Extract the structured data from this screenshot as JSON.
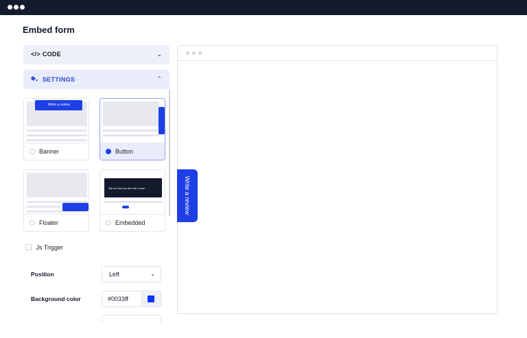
{
  "page": {
    "title": "Embed form"
  },
  "code_section": {
    "label": "CODE",
    "icon": "code-icon"
  },
  "settings_section": {
    "label": "SETTINGS",
    "icon": "paint-bucket-icon"
  },
  "layouts": [
    {
      "label": "Banner",
      "selected": false,
      "preview_text": "Write a review"
    },
    {
      "label": "Button",
      "selected": true,
      "preview_text": "Write a review"
    },
    {
      "label": "Floater",
      "selected": false,
      "preview_text": "Write a review"
    },
    {
      "label": "Embedded",
      "selected": false,
      "preview_text": "Tell us how you like the cream"
    }
  ],
  "js_trigger": {
    "label": "Js Trigger",
    "checked": false
  },
  "position": {
    "label": "Position",
    "value": "Left"
  },
  "background_color": {
    "label": "Background color",
    "value": "#0033ff"
  },
  "preview": {
    "review_button_label": "Write a review"
  },
  "colors": {
    "accent": "#1f3fe6",
    "topbar": "#141b2d"
  }
}
